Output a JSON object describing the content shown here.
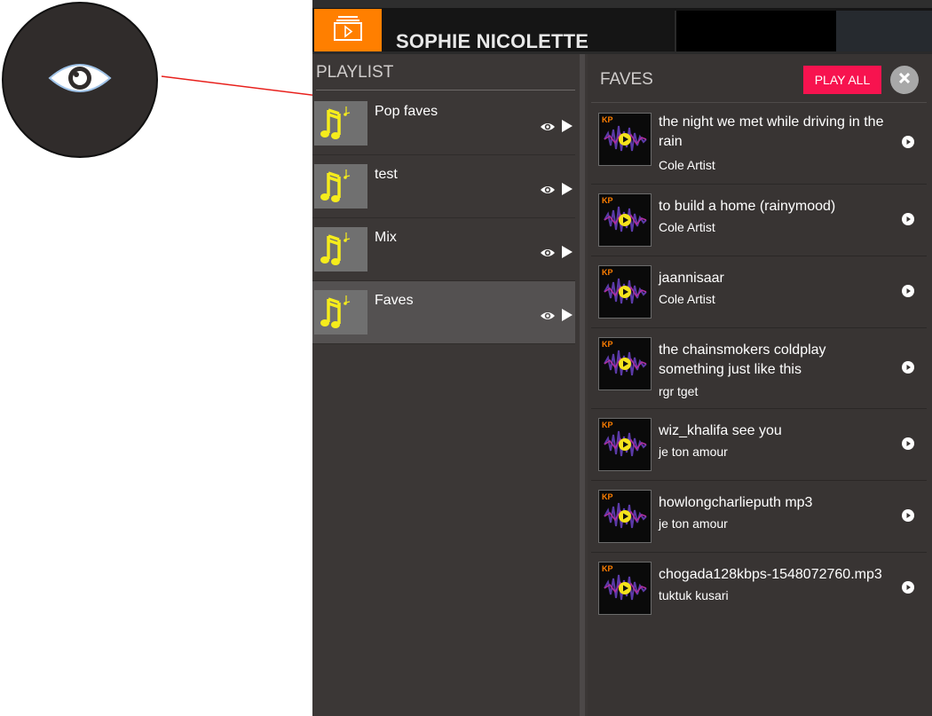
{
  "header": {
    "artist_name": "SOPHIE NICOLETTE"
  },
  "playlist": {
    "heading": "PLAYLIST",
    "items": [
      {
        "name": "Pop faves",
        "selected": false
      },
      {
        "name": "test",
        "selected": false
      },
      {
        "name": "Mix",
        "selected": false
      },
      {
        "name": "Faves",
        "selected": true
      }
    ]
  },
  "faves": {
    "heading": "FAVES",
    "play_all_label": "PLAY ALL",
    "tracks": [
      {
        "title_line1": "the night we met while driving in the",
        "title_line2": "rain",
        "artist": "Cole Artist"
      },
      {
        "title_line1": "to build a home (rainymood)",
        "title_line2": "",
        "artist": "Cole Artist"
      },
      {
        "title_line1": "jaannisaar",
        "title_line2": "",
        "artist": "Cole Artist"
      },
      {
        "title_line1": "the chainsmokers coldplay",
        "title_line2": "something just like this",
        "artist": "rgr tget"
      },
      {
        "title_line1": "wiz_khalifa see you",
        "title_line2": "",
        "artist": "je ton amour"
      },
      {
        "title_line1": "howlongcharlieputh mp3",
        "title_line2": "",
        "artist": "je ton amour"
      },
      {
        "title_line1": "chogada128kbps-1548072760.mp3",
        "title_line2": "",
        "artist": "tuktuk kusari"
      }
    ]
  },
  "colors": {
    "accent_orange": "#ff7f00",
    "play_all_pink": "#f7134f",
    "panel_bg": "#3b3736",
    "annotation_red": "#e8201c"
  },
  "icons": {
    "zoom": "eye-icon",
    "logo": "video-playlist-icon",
    "playlist_thumb": "music-notes-icon",
    "view": "eye-icon",
    "play": "play-triangle-icon",
    "close": "close-icon",
    "track_play": "play-circle-icon"
  }
}
